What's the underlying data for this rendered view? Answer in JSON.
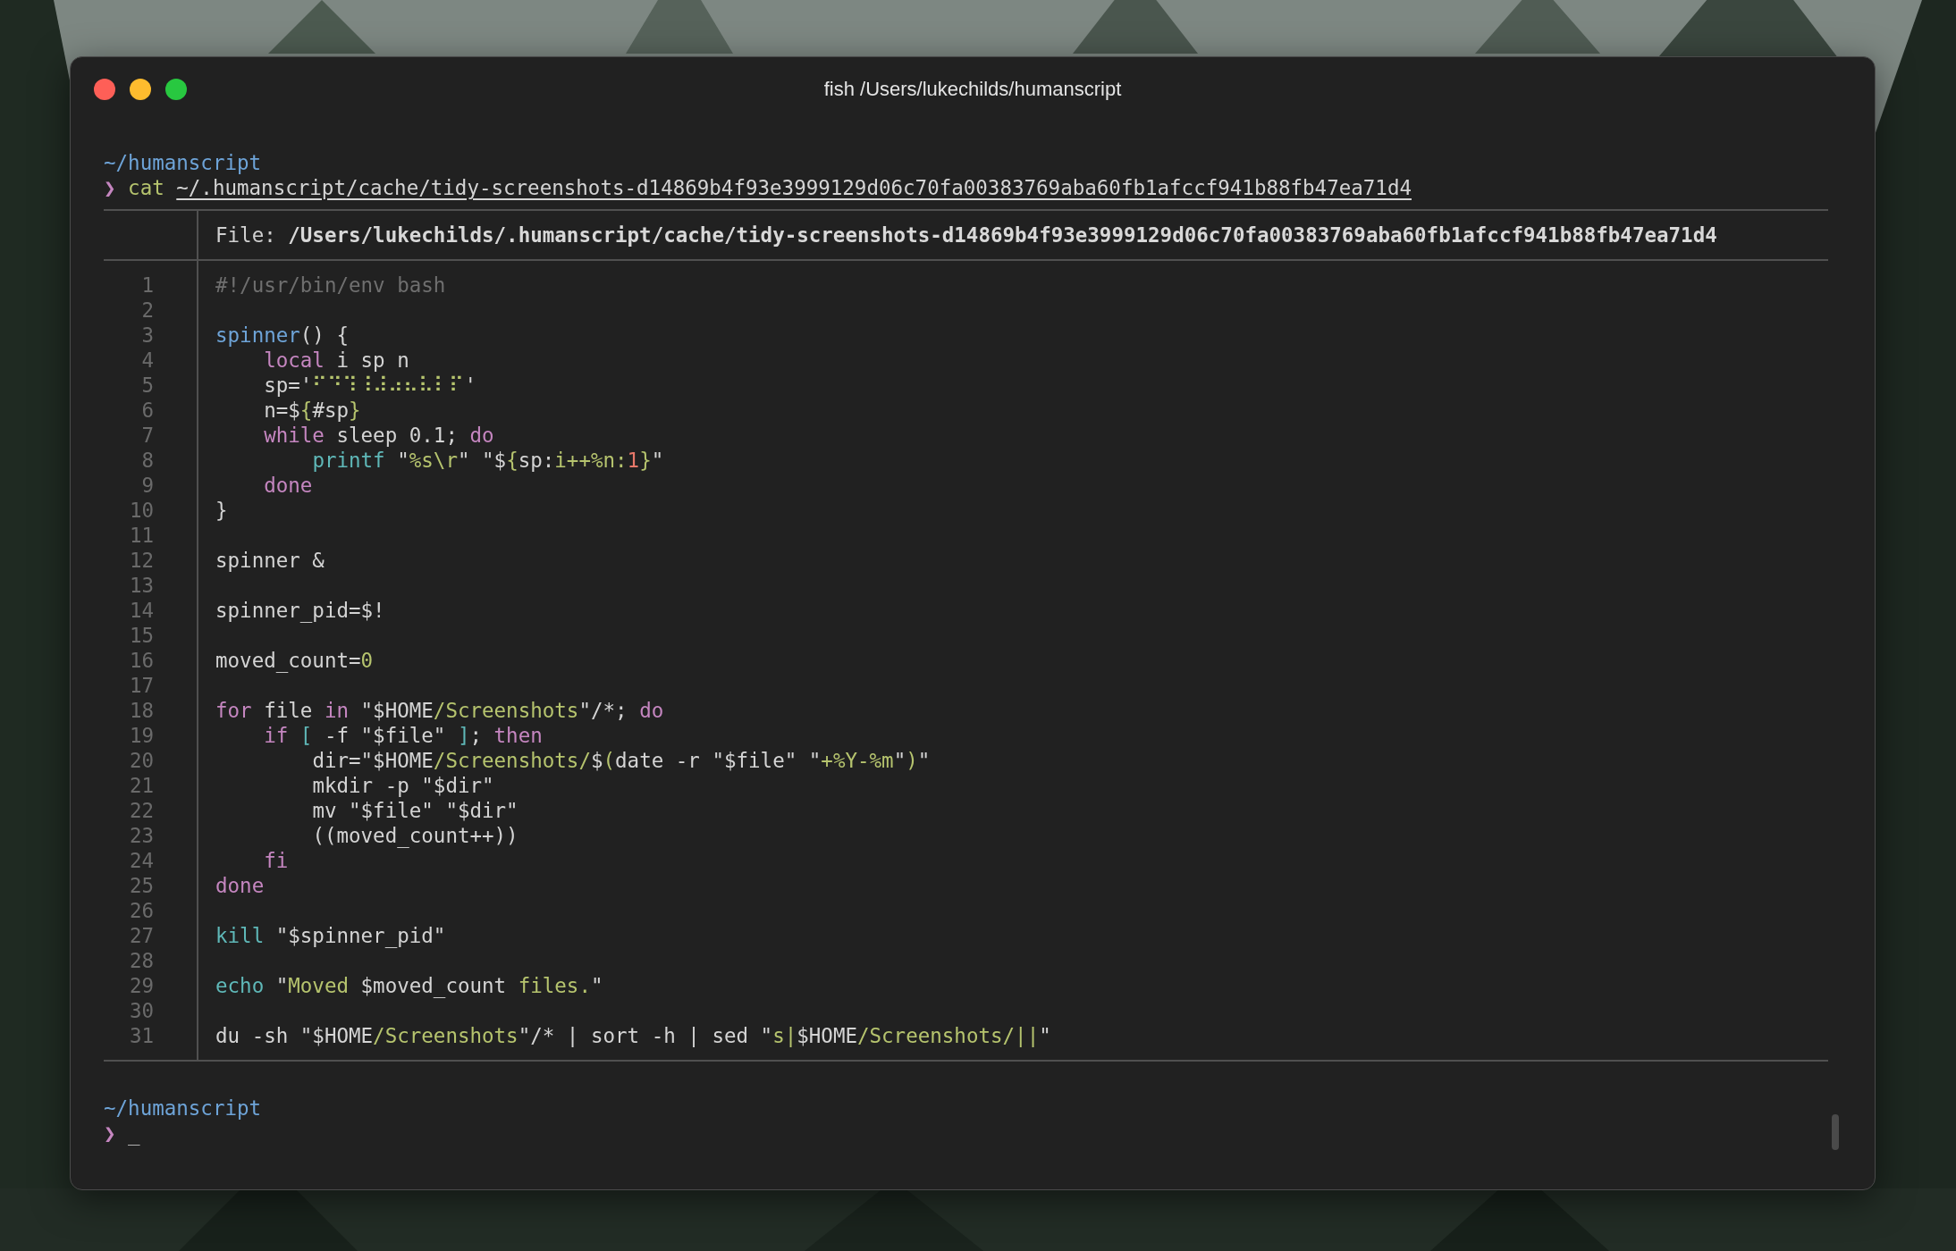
{
  "window": {
    "title": "fish /Users/lukechilds/humanscript"
  },
  "command": {
    "cwd": "~/humanscript",
    "prompt": "❯",
    "program": "cat",
    "argument": "~/.humanscript/cache/tidy-screenshots-d14869b4f93e3999129d06c70fa00383769aba60fb1afccf941b88fb47ea71d4"
  },
  "listing": {
    "header": "File: **/Users/lukechilds/.humanscript/cache/tidy-screenshots-d14869b4f93e3999129d06c70fa00383769aba60fb1afccf941b88fb47ea71d4**",
    "lines": [
      {
        "number": "1",
        "tokens": [
          {
            "kind": "comment",
            "text": "#!/usr/bin/env bash"
          }
        ]
      },
      {
        "number": "2"
      },
      {
        "number": "3",
        "tokens": [
          {
            "kind": "function",
            "text": "spinner"
          },
          {
            "kind": "plain",
            "text": "() {"
          }
        ]
      },
      {
        "number": "4",
        "tokens": [
          {
            "kind": "keyword",
            "text": "    local"
          },
          {
            "kind": "plain",
            "text": " i sp n"
          }
        ]
      },
      {
        "number": "5",
        "tokens": [
          {
            "kind": "plain",
            "text": "    sp='"
          },
          {
            "kind": "string",
            "text": "⠋⠙⠹⠸⠼⠴⠦⠧⠇⠏"
          },
          {
            "kind": "plain",
            "text": "'"
          }
        ]
      },
      {
        "number": "6",
        "tokens": [
          {
            "kind": "plain",
            "text": "    n=$"
          },
          {
            "kind": "string",
            "text": "{"
          },
          {
            "kind": "plain",
            "text": "#sp"
          },
          {
            "kind": "string",
            "text": "}"
          }
        ]
      },
      {
        "number": "7",
        "tokens": [
          {
            "kind": "keyword",
            "text": "    while"
          },
          {
            "kind": "plain",
            "text": " sleep 0.1; "
          },
          {
            "kind": "keyword",
            "text": "do"
          }
        ]
      },
      {
        "number": "8",
        "tokens": [
          {
            "kind": "builtin",
            "text": "        printf"
          },
          {
            "kind": "plain",
            "text": " \""
          },
          {
            "kind": "string",
            "text": "%s\\r"
          },
          {
            "kind": "plain",
            "text": "\" \"$"
          },
          {
            "kind": "string",
            "text": "{"
          },
          {
            "kind": "plain",
            "text": "sp:"
          },
          {
            "kind": "string",
            "text": "i++%n:"
          },
          {
            "kind": "number",
            "text": "1"
          },
          {
            "kind": "string",
            "text": "}"
          },
          {
            "kind": "plain",
            "text": "\""
          }
        ]
      },
      {
        "number": "9",
        "tokens": [
          {
            "kind": "keyword",
            "text": "    done"
          }
        ]
      },
      {
        "number": "10",
        "tokens": [
          {
            "kind": "plain",
            "text": "}"
          }
        ]
      },
      {
        "number": "11"
      },
      {
        "number": "12",
        "tokens": [
          {
            "kind": "plain",
            "text": "spinner &"
          }
        ]
      },
      {
        "number": "13"
      },
      {
        "number": "14",
        "tokens": [
          {
            "kind": "plain",
            "text": "spinner_pid=$!"
          }
        ]
      },
      {
        "number": "15"
      },
      {
        "number": "16",
        "tokens": [
          {
            "kind": "plain",
            "text": "moved_count="
          },
          {
            "kind": "string",
            "text": "0"
          }
        ]
      },
      {
        "number": "17"
      },
      {
        "number": "18",
        "tokens": [
          {
            "kind": "keyword",
            "text": "for"
          },
          {
            "kind": "plain",
            "text": " file "
          },
          {
            "kind": "keyword",
            "text": "in"
          },
          {
            "kind": "plain",
            "text": " \"$HOME"
          },
          {
            "kind": "string",
            "text": "/Screenshots"
          },
          {
            "kind": "plain",
            "text": "\"/*; "
          },
          {
            "kind": "keyword",
            "text": "do"
          }
        ]
      },
      {
        "number": "19",
        "tokens": [
          {
            "kind": "keyword",
            "text": "    if"
          },
          {
            "kind": "builtin",
            "text": " ["
          },
          {
            "kind": "plain",
            "text": " -f \"$file\" "
          },
          {
            "kind": "builtin",
            "text": "]"
          },
          {
            "kind": "plain",
            "text": "; "
          },
          {
            "kind": "keyword",
            "text": "then"
          }
        ]
      },
      {
        "number": "20",
        "tokens": [
          {
            "kind": "plain",
            "text": "        dir=\"$HOME"
          },
          {
            "kind": "string",
            "text": "/Screenshots/"
          },
          {
            "kind": "plain",
            "text": "$"
          },
          {
            "kind": "string",
            "text": "("
          },
          {
            "kind": "plain",
            "text": "date -r \"$file\" \""
          },
          {
            "kind": "string",
            "text": "+%Y-%m"
          },
          {
            "kind": "plain",
            "text": "\""
          },
          {
            "kind": "string",
            "text": ")"
          },
          {
            "kind": "plain",
            "text": "\""
          }
        ]
      },
      {
        "number": "21",
        "tokens": [
          {
            "kind": "plain",
            "text": "        mkdir -p \"$dir\""
          }
        ]
      },
      {
        "number": "22",
        "tokens": [
          {
            "kind": "plain",
            "text": "        mv \"$file\" \"$dir\""
          }
        ]
      },
      {
        "number": "23",
        "tokens": [
          {
            "kind": "plain",
            "text": "        ((moved_count++))"
          }
        ]
      },
      {
        "number": "24",
        "tokens": [
          {
            "kind": "keyword",
            "text": "    fi"
          }
        ]
      },
      {
        "number": "25",
        "tokens": [
          {
            "kind": "keyword",
            "text": "done"
          }
        ]
      },
      {
        "number": "26"
      },
      {
        "number": "27",
        "tokens": [
          {
            "kind": "builtin",
            "text": "kill"
          },
          {
            "kind": "plain",
            "text": " \"$spinner_pid\""
          }
        ]
      },
      {
        "number": "28"
      },
      {
        "number": "29",
        "tokens": [
          {
            "kind": "builtin",
            "text": "echo"
          },
          {
            "kind": "plain",
            "text": " \""
          },
          {
            "kind": "string",
            "text": "Moved"
          },
          {
            "kind": "plain",
            "text": " $moved_count "
          },
          {
            "kind": "string",
            "text": "files."
          },
          {
            "kind": "plain",
            "text": "\""
          }
        ]
      },
      {
        "number": "30"
      },
      {
        "number": "31",
        "tokens": [
          {
            "kind": "plain",
            "text": "du -sh \"$HOME"
          },
          {
            "kind": "string",
            "text": "/Screenshots"
          },
          {
            "kind": "plain",
            "text": "\"/* | sort -h | sed \""
          },
          {
            "kind": "string",
            "text": "s|"
          },
          {
            "kind": "plain",
            "text": "$HOME"
          },
          {
            "kind": "string",
            "text": "/Screenshots/||"
          },
          {
            "kind": "plain",
            "text": "\""
          }
        ]
      }
    ]
  },
  "next_prompt": {
    "cwd": "~/humanscript",
    "prompt": "❯",
    "cursor": "_"
  }
}
